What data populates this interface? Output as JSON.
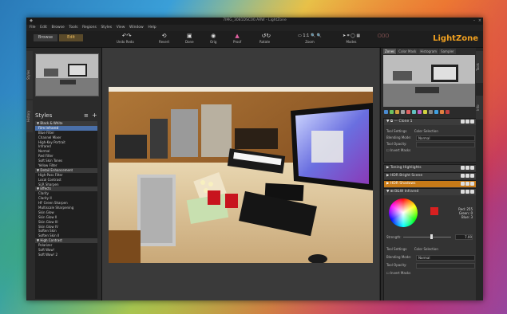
{
  "app": {
    "title": "7IMG_3081DSC00.ARW - LightZone",
    "logo": "LightZone"
  },
  "menu": [
    "File",
    "Edit",
    "Browse",
    "Tools",
    "Regions",
    "Styles",
    "View",
    "Window",
    "Help"
  ],
  "mode_tabs": {
    "browse": "Browse",
    "edit": "Edit"
  },
  "toolbar": {
    "undo_redo": "Undo Redo",
    "revert": "Revert",
    "done": "Done",
    "orig": "Orig",
    "proof": "Proof",
    "rotate": "Rotate",
    "zoom": "Zoom",
    "modes": "Modes",
    "zoom_fit": "1:1"
  },
  "left": {
    "tab_styles": "Styles",
    "tab_history": "History",
    "styles_header": "Styles",
    "styles": [
      {
        "label": "Black & White",
        "group": true
      },
      {
        "label": "Film Infrared",
        "selected": true
      },
      {
        "label": "Blue Filter"
      },
      {
        "label": "Channel Mixer"
      },
      {
        "label": "High-Key Portrait"
      },
      {
        "label": "Infrared"
      },
      {
        "label": "Normal"
      },
      {
        "label": "Red Filter"
      },
      {
        "label": "Soft Skin Tones"
      },
      {
        "label": "Yellow Filter"
      },
      {
        "label": "Detail Enhancement",
        "group": true
      },
      {
        "label": "High-Pass Filter"
      },
      {
        "label": "Local Contrast"
      },
      {
        "label": "SLR Sharpen"
      },
      {
        "label": "Effects",
        "group": true
      },
      {
        "label": "Clarity"
      },
      {
        "label": "Clarity II"
      },
      {
        "label": "HF Green Sharpen"
      },
      {
        "label": "Multiscale Sharpening"
      },
      {
        "label": "Skin Glow"
      },
      {
        "label": "Skin Glow II"
      },
      {
        "label": "Skin Glow III"
      },
      {
        "label": "Skin Glow IV"
      },
      {
        "label": "Soften Skin"
      },
      {
        "label": "Soften Skin II"
      },
      {
        "label": "High Contrast",
        "group": true
      },
      {
        "label": "Polarizer"
      },
      {
        "label": "Soft Wow!"
      },
      {
        "label": "Soft Wow! 2"
      }
    ]
  },
  "right": {
    "tabs": [
      "Zones",
      "Color Mask",
      "Histogram",
      "Sampler"
    ],
    "side_tabs": [
      "Tools",
      "Info"
    ],
    "clone_title": "Clone 1",
    "tool_settings": "Tool Settings",
    "color_selection": "Color Selection",
    "blending_mode_label": "Blending Mode:",
    "blending_mode_value": "Normal",
    "tool_opacity_label": "Tool Opacity:",
    "invert_masks": "Invert Masks",
    "layers": [
      "Toning Highlights",
      "HDR Bright Scene",
      "HDR Shadows"
    ],
    "bw_title": "B&W Infrared",
    "rgb": {
      "red": "Red: 255",
      "green": "Green: 0",
      "blue": "Blue: 3"
    },
    "strength_label": "Strength:",
    "strength_value": "7.00"
  }
}
